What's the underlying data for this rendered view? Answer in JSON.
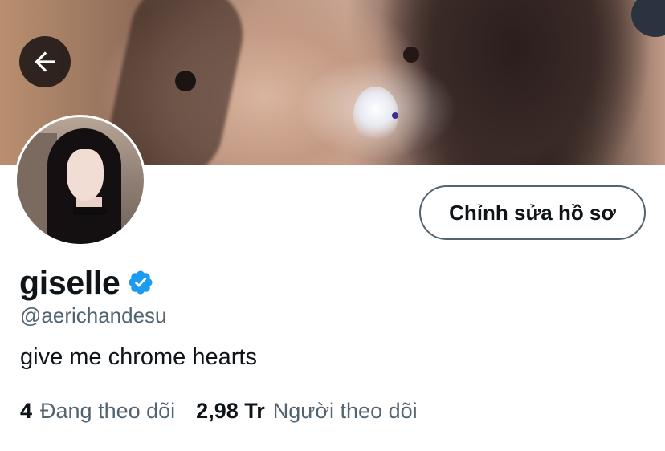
{
  "profile": {
    "name": "giselle",
    "handle": "@aerichandesu",
    "bio": "give me chrome hearts",
    "verified": true
  },
  "actions": {
    "edit_profile_label": "Chỉnh sửa hồ sơ",
    "back_icon": "arrow-left-icon"
  },
  "stats": {
    "following_count": "4",
    "following_label": "Đang theo dõi",
    "followers_count": "2,98 Tr",
    "followers_label": "Người theo dõi"
  },
  "colors": {
    "text_primary": "#0f1419",
    "text_secondary": "#536471",
    "verified_blue": "#1d9bf0",
    "button_border": "#536471"
  }
}
